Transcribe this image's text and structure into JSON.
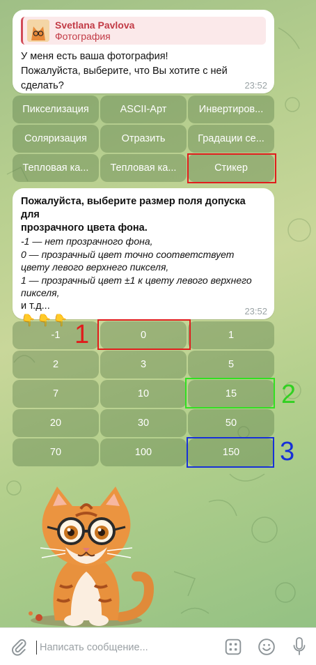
{
  "message1": {
    "reply_author": "Svetlana Pavlova",
    "reply_preview": "Фотография",
    "text_line1": "У меня есть ваша фотография!",
    "text_line2": "Пожалуйста, выберите, что Вы хотите с ней",
    "text_line3": "сделать?",
    "time": "23:52"
  },
  "keyboard1": {
    "buttons": [
      "Пикселизация",
      "ASCII-Арт",
      "Инвертиров...",
      "Соляризация",
      "Отразить",
      "Градации се...",
      "Тепловая ка...",
      "Тепловая ка...",
      "Стикер"
    ]
  },
  "message2": {
    "title_line1": "Пожалуйста, выберите размер поля допуска для",
    "title_line2": "прозрачного цвета фона.",
    "line1": " -1 — нет прозрачного фона,",
    "line2": " 0 — прозрачный цвет точно соответствует",
    "line3": "цвету левого верхнего пикселя,",
    "line4": " 1 — прозрачный цвет ±1 к цвету левого верхнего",
    "line5": "пикселя,",
    "line6": "и т.д...",
    "hands": "👇👇👇",
    "time": "23:52"
  },
  "keyboard2": {
    "buttons": [
      "-1",
      "0",
      "1",
      "2",
      "3",
      "5",
      "7",
      "10",
      "15",
      "20",
      "30",
      "50",
      "70",
      "100",
      "150"
    ]
  },
  "annotations": {
    "label1": "1",
    "label2": "2",
    "label3": "3",
    "color1": "#e01c1c",
    "color2": "#32e022",
    "color3": "#1730d8"
  },
  "composer": {
    "placeholder": "Написать сообщение..."
  },
  "icons": {
    "attach": "paperclip-icon",
    "keyboard": "bot-keyboard-icon",
    "emoji": "smiley-icon",
    "mic": "microphone-icon"
  }
}
